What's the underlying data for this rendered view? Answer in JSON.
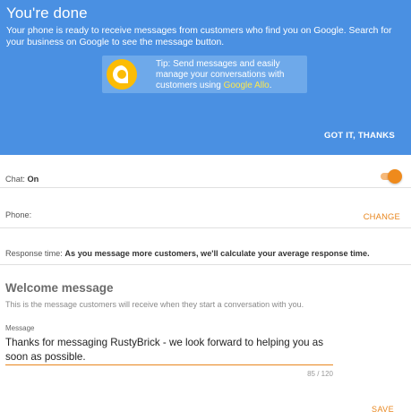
{
  "banner": {
    "title": "You're done",
    "description": "Your phone is ready to receive messages from customers who find you on Google. Search for your business on Google to see the message button.",
    "tip_prefix": "Tip: Send messages and easily manage your conversations with customers using ",
    "tip_link": "Google Allo",
    "tip_suffix": ".",
    "got_it_label": "GOT IT, THANKS",
    "background_color": "#4a90e2",
    "icon": "google-allo-icon"
  },
  "chat": {
    "label": "Chat: ",
    "value": "On",
    "toggle_on": true,
    "toggle_color": "#ef8a1c"
  },
  "phone": {
    "label": "Phone:",
    "change_label": "CHANGE"
  },
  "response_time": {
    "label": "Response time: ",
    "value": "As you message more customers, we'll calculate your average response time."
  },
  "welcome": {
    "title": "Welcome message",
    "subtitle": "This is the message customers will receive when they start a conversation with you.",
    "field_label": "Message",
    "message": "Thanks for messaging RustyBrick - we look forward to helping you as soon as possible.",
    "counter": "85 / 120",
    "save_label": "SAVE",
    "accent_color": "#e8861d"
  }
}
